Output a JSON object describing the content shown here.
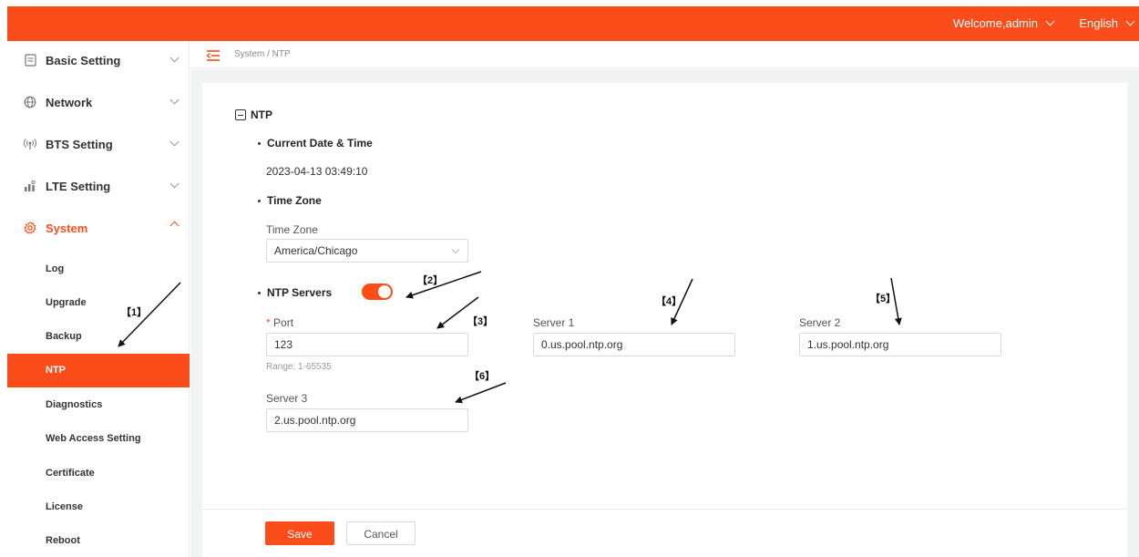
{
  "header": {
    "welcome": "Welcome,admin",
    "language": "English",
    "brand_color": "#fa4d1a"
  },
  "sidebar": {
    "items": [
      {
        "label": "Basic Setting",
        "icon": "document-icon"
      },
      {
        "label": "Network",
        "icon": "globe-icon"
      },
      {
        "label": "BTS Setting",
        "icon": "antenna-icon"
      },
      {
        "label": "LTE Setting",
        "icon": "network-tower-icon"
      },
      {
        "label": "System",
        "icon": "gear-icon",
        "expanded": true
      }
    ],
    "sub_items": [
      {
        "label": "Log"
      },
      {
        "label": "Upgrade"
      },
      {
        "label": "Backup"
      },
      {
        "label": "NTP",
        "active": true
      },
      {
        "label": "Diagnostics"
      },
      {
        "label": "Web Access Setting"
      },
      {
        "label": "Certificate"
      },
      {
        "label": "License"
      },
      {
        "label": "Reboot"
      }
    ]
  },
  "breadcrumb": "System / NTP",
  "ntp": {
    "section_title": "NTP",
    "current_datetime_label": "Current Date & Time",
    "current_datetime_value": "2023-04-13 03:49:10",
    "timezone_section_label": "Time Zone",
    "timezone_field_label": "Time Zone",
    "timezone_value": "America/Chicago",
    "ntp_servers_label": "NTP Servers",
    "ntp_servers_enabled": true,
    "port_label": "Port",
    "port_required_mark": "*",
    "port_value": "123",
    "port_hint": "Range: 1-65535",
    "server1_label": "Server 1",
    "server1_value": "0.us.pool.ntp.org",
    "server2_label": "Server 2",
    "server2_value": "1.us.pool.ntp.org",
    "server3_label": "Server 3",
    "server3_value": "2.us.pool.ntp.org"
  },
  "footer": {
    "save_label": "Save",
    "cancel_label": "Cancel"
  },
  "annotations": [
    "【1】",
    "【2】",
    "【3】",
    "【4】",
    "【5】",
    "【6】"
  ]
}
